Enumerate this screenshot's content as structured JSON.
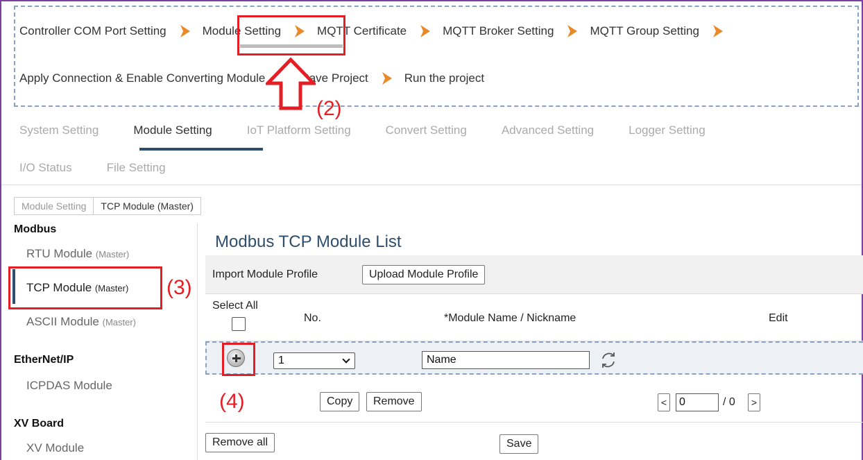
{
  "wizard": {
    "steps_row1": [
      "Controller COM Port Setting",
      "Module Setting",
      "MQTT Certificate",
      "MQTT Broker Setting",
      "MQTT Group Setting"
    ],
    "steps_row2": [
      "Apply Connection & Enable Converting Module",
      "Save Project",
      "Run the project"
    ],
    "active_step": "Module Setting"
  },
  "annotations": {
    "step2": "(2)",
    "step3": "(3)",
    "step4": "(4)"
  },
  "tabs": {
    "row1": [
      "System Setting",
      "Module Setting",
      "IoT Platform Setting",
      "Convert Setting",
      "Advanced Setting",
      "Logger Setting"
    ],
    "row2": [
      "I/O Status",
      "File Setting"
    ],
    "active": "Module Setting"
  },
  "breadcrumb": [
    "Module Setting",
    "TCP Module (Master)"
  ],
  "sidebar": {
    "groups": [
      {
        "title": "Modbus",
        "items": [
          {
            "label": "RTU Module",
            "tag": "(Master)"
          },
          {
            "label": "TCP Module",
            "tag": "(Master)"
          },
          {
            "label": "ASCII Module",
            "tag": "(Master)"
          }
        ]
      },
      {
        "title": "EtherNet/IP",
        "items": [
          {
            "label": "ICPDAS Module",
            "tag": ""
          }
        ]
      },
      {
        "title": "XV Board",
        "items": [
          {
            "label": "XV Module",
            "tag": ""
          }
        ]
      }
    ],
    "active_item": "TCP Module"
  },
  "content": {
    "title": "Modbus TCP Module List",
    "import_label": "Import Module Profile",
    "upload_button": "Upload Module Profile",
    "columns": {
      "select_all": "Select All",
      "no": "No.",
      "name": "*Module Name / Nickname",
      "edit": "Edit"
    },
    "new_row": {
      "no_value": "1",
      "name_value": "Name"
    },
    "copy_button": "Copy",
    "remove_button": "Remove",
    "pager": {
      "prev": "<",
      "current": "0",
      "total": "/ 0",
      "next": ">"
    },
    "remove_all_button": "Remove all",
    "save_button": "Save"
  },
  "colors": {
    "highlight": "#e31e24",
    "accent": "#2d4e6c",
    "chevron": "#e8892a",
    "frame": "#7b3fa0"
  }
}
